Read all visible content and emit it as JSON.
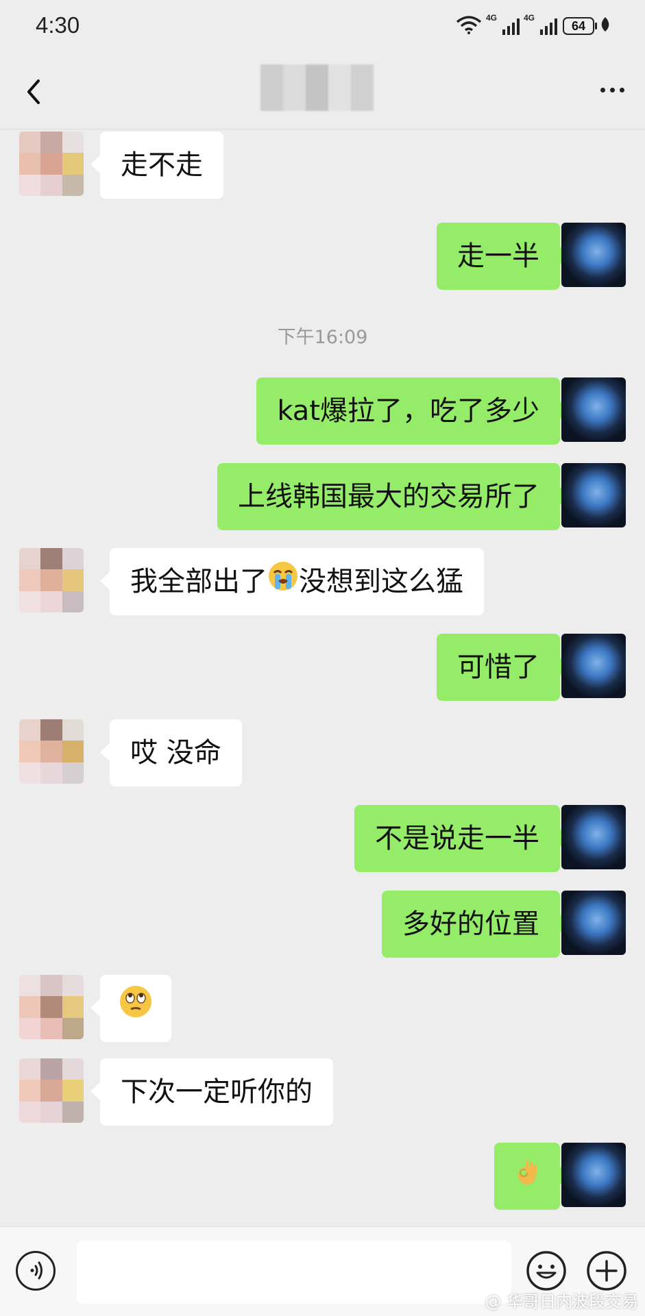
{
  "status_bar": {
    "time": "4:30",
    "network_1": "4G",
    "network_2": "4G",
    "battery": "64",
    "icons": [
      "wifi-icon",
      "signal-icon",
      "signal-icon",
      "battery-icon",
      "leaf-icon"
    ]
  },
  "nav": {
    "title": "",
    "back_icon": "chevron-left-icon",
    "more_icon": "more-dots-icon"
  },
  "timestamp": "下午16:09",
  "messages": [
    {
      "sender": "other",
      "text": "走不走"
    },
    {
      "sender": "me",
      "text": "走一半"
    },
    {
      "sender": "me",
      "text": "kat爆拉了，吃了多少"
    },
    {
      "sender": "me",
      "text": "上线韩国最大的交易所了"
    },
    {
      "sender": "other",
      "text_before": "我全部出了",
      "emoji": "loudly-crying-face",
      "text_after": "没想到这么猛"
    },
    {
      "sender": "me",
      "text": "可惜了"
    },
    {
      "sender": "other",
      "text": "哎 没命"
    },
    {
      "sender": "me",
      "text": "不是说走一半"
    },
    {
      "sender": "me",
      "text": "多好的位置"
    },
    {
      "sender": "other",
      "emoji": "face-with-rolling-eyes"
    },
    {
      "sender": "other",
      "text": "下次一定听你的"
    },
    {
      "sender": "me",
      "emoji": "ok-hand"
    }
  ],
  "input_bar": {
    "placeholder": "",
    "icons": [
      "voice-icon",
      "emoji-icon",
      "plus-icon"
    ]
  },
  "watermark": "@ 华哥日内波段交易",
  "colors": {
    "background": "#ededed",
    "bubble_me": "#95ec69",
    "bubble_other": "#ffffff",
    "timestamp": "#999999"
  }
}
